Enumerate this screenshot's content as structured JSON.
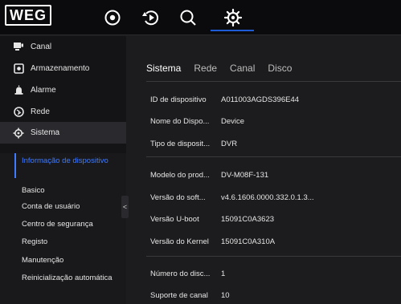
{
  "logo": {
    "text": "WEG"
  },
  "topbar": {
    "icons": [
      "live-view-icon",
      "playback-icon",
      "search-icon",
      "settings-icon"
    ]
  },
  "sidebar": {
    "items": [
      {
        "label": "Canal",
        "icon": "camera-icon"
      },
      {
        "label": "Armazenamento",
        "icon": "storage-icon"
      },
      {
        "label": "Alarme",
        "icon": "alarm-icon"
      },
      {
        "label": "Rede",
        "icon": "network-icon"
      },
      {
        "label": "Sistema",
        "icon": "system-gear-icon"
      }
    ],
    "submenu": [
      {
        "label": "Informação de dispositivo"
      },
      {
        "label": "Basico"
      },
      {
        "label": "Conta de usuário"
      },
      {
        "label": "Centro de segurança"
      },
      {
        "label": "Registo"
      },
      {
        "label": "Manutenção"
      },
      {
        "label": "Reinicialização automática"
      }
    ],
    "collapse_glyph": "<"
  },
  "tabs": [
    {
      "label": "Sistema"
    },
    {
      "label": "Rede"
    },
    {
      "label": "Canal"
    },
    {
      "label": "Disco"
    }
  ],
  "fields": [
    {
      "label": "ID de dispositivo",
      "value": "A011003AGDS396E44"
    },
    {
      "label": "Nome do Dispo...",
      "value": "Device"
    },
    {
      "label": "Tipo de disposit...",
      "value": "DVR"
    },
    {
      "label": "Modelo do prod...",
      "value": "DV-M08F-131"
    },
    {
      "label": "Versão do soft...",
      "value": "v4.6.1606.0000.332.0.1.3..."
    },
    {
      "label": "Versão U-boot",
      "value": "15091C0A3623"
    },
    {
      "label": "Versão do Kernel",
      "value": "15091C0A310A"
    },
    {
      "label": "Número do disc...",
      "value": "1"
    },
    {
      "label": "Suporte de canal",
      "value": "10"
    }
  ],
  "colors": {
    "accent": "#1e5bd6",
    "submenu_active": "#3f7bff"
  }
}
